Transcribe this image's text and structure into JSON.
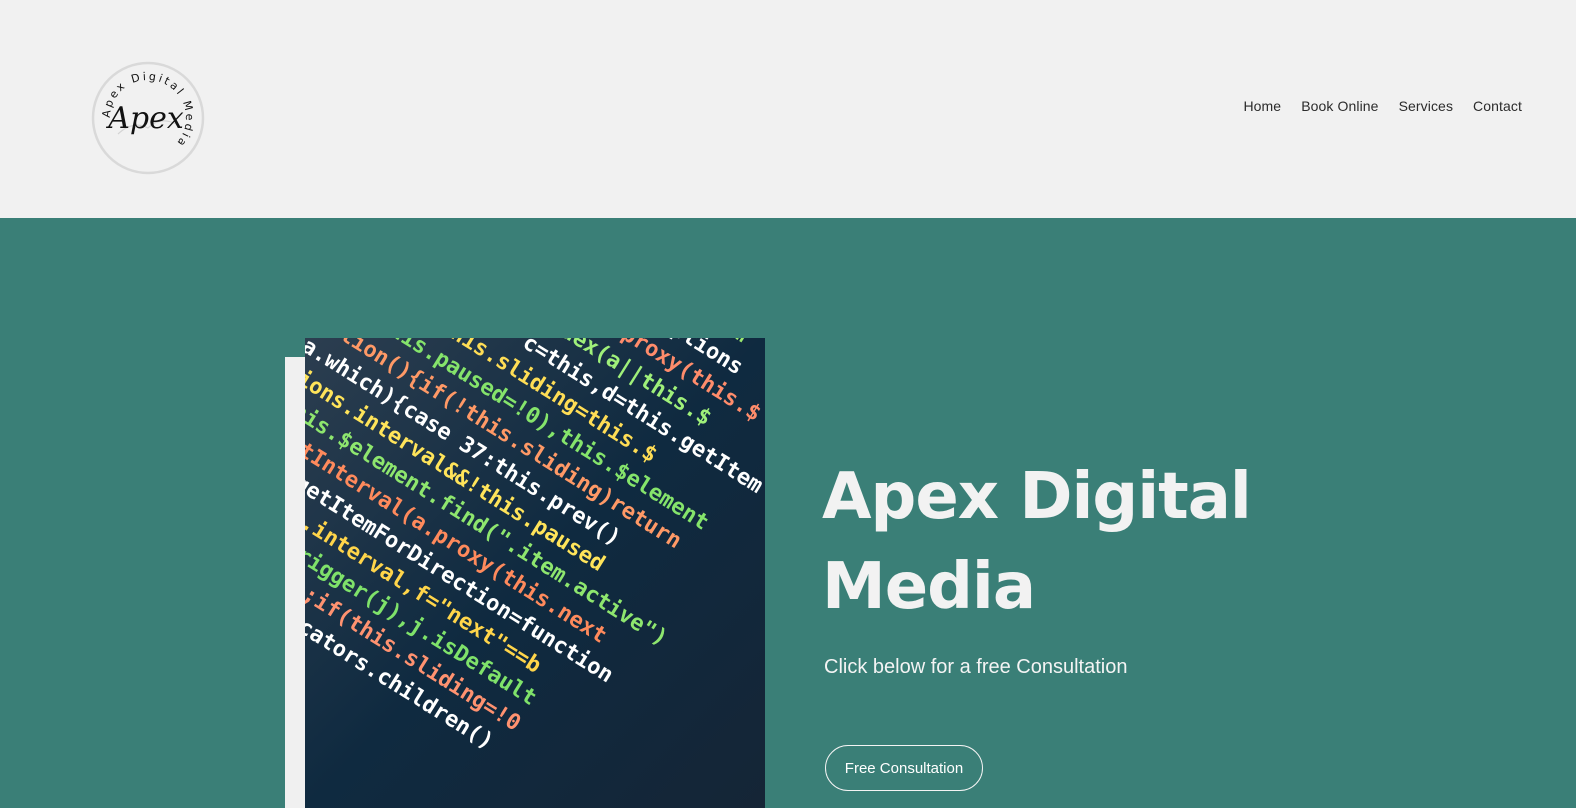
{
  "brand": {
    "logo_text": "Apex",
    "logo_ring_text": "Apex Digital Media"
  },
  "nav": {
    "items": [
      {
        "label": "Home"
      },
      {
        "label": "Book Online"
      },
      {
        "label": "Services"
      },
      {
        "label": "Contact"
      }
    ]
  },
  "hero": {
    "title": "Apex Digital Media",
    "subtitle": "Click below for a free Consultation",
    "cta_label": "Free Consultation",
    "image_subject": "colorful-source-code-photo"
  },
  "colors": {
    "header_bg": "#f1f1f1",
    "hero_bg": "#3a7f77",
    "text_light": "#f2f2f2"
  }
}
